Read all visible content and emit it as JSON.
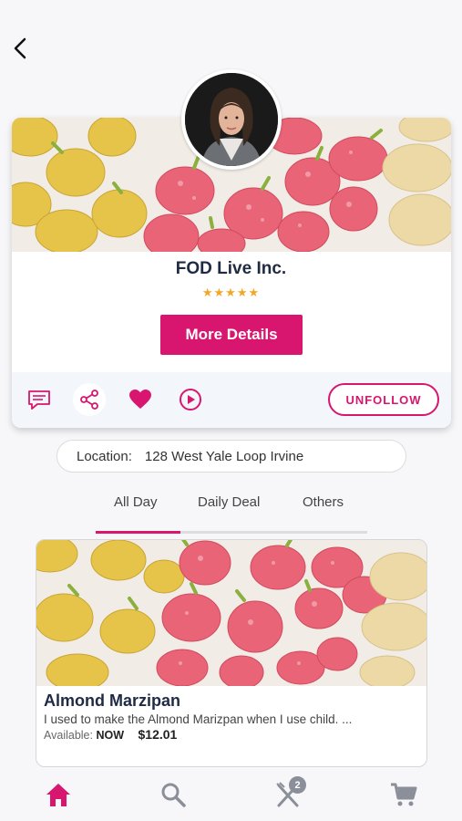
{
  "colors": {
    "accent": "#d8166f",
    "title": "#1f2a44",
    "star": "#f5a623",
    "nav_inactive": "#8a8f99"
  },
  "header": {
    "back_icon": "chevron-left-icon"
  },
  "business": {
    "name": "FOD Live Inc.",
    "rating": 5,
    "rating_text": "★★★★★",
    "more_details_label": "More Details"
  },
  "actions": {
    "icons": [
      "chat-icon",
      "share-icon",
      "heart-icon",
      "play-icon"
    ],
    "unfollow_label": "UNFOLLOW"
  },
  "location": {
    "label": "Location:",
    "value": "128 West Yale Loop Irvine"
  },
  "tabs": [
    {
      "label": "All Day",
      "active": true
    },
    {
      "label": "Daily Deal",
      "active": false
    },
    {
      "label": "Others",
      "active": false
    }
  ],
  "dish": {
    "name": "Almond Marzipan",
    "description": "I used to make the Almond Marizpan when I use child. ...",
    "available_label": "Available:",
    "available_value": "NOW",
    "price": "$12.01"
  },
  "bottom_nav": {
    "items": [
      "home-icon",
      "search-icon",
      "dining-icon",
      "cart-icon"
    ],
    "badge_count": "2"
  }
}
